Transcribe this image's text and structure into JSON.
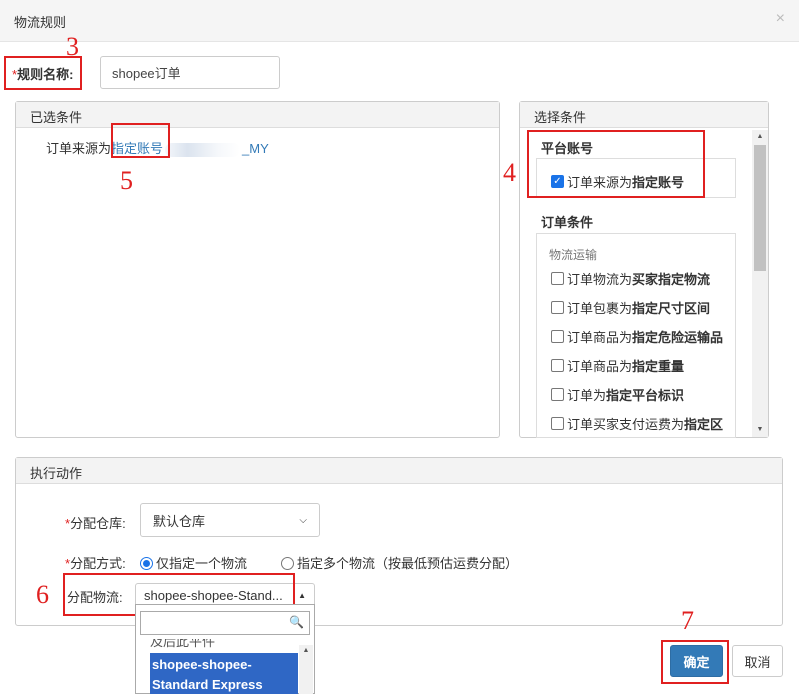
{
  "dialog": {
    "title": "物流规则",
    "close_glyph": "×"
  },
  "annotations": [
    "3",
    "4",
    "5",
    "6",
    "7"
  ],
  "rule_name": {
    "required_mark": "*",
    "label": "规则名称:",
    "value": "shopee订单"
  },
  "selected_panel": {
    "header": "已选条件",
    "condition_prefix": "订单来源为",
    "condition_link": "指定账号",
    "condition_suffix": "_MY"
  },
  "choose_panel": {
    "header": "选择条件",
    "platform_section": "平台账号",
    "platform_option": {
      "prefix": "订单来源为",
      "bold": "指定账号",
      "checked": true
    },
    "order_section": "订单条件",
    "logistics_group": "物流运输",
    "options": [
      {
        "prefix": "订单物流为",
        "bold": "买家指定物流"
      },
      {
        "prefix": "订单包裹为",
        "bold": "指定尺寸区间"
      },
      {
        "prefix": "订单商品为",
        "bold": "指定危险运输品"
      },
      {
        "prefix": "订单商品为",
        "bold": "指定重量"
      },
      {
        "prefix": "订单为",
        "bold": "指定平台标识"
      },
      {
        "prefix": "订单买家支付运费为",
        "bold": "指定区"
      }
    ]
  },
  "action_panel": {
    "header": "执行动作",
    "warehouse_label": "分配仓库:",
    "warehouse_value": "默认仓库",
    "method_label": "分配方式:",
    "method_single": "仅指定一个物流",
    "method_multi": "指定多个物流（按最低预估运费分配）",
    "logistics_label": "分配物流:",
    "logistics_value": "shopee-shopee-Stand...",
    "required_mark": "*"
  },
  "dropdown": {
    "search_value": "",
    "cut_text": "及后此平件",
    "selected_option": "shopee-shopee-Standard Express"
  },
  "buttons": {
    "confirm": "确定",
    "cancel": "取消"
  },
  "colors": {
    "accent": "#337ab7",
    "annotation_red": "#e02020",
    "selected_option_bg": "#2f67c5"
  },
  "icons": [
    "close-icon",
    "checkbox-icon",
    "radio-icon",
    "chevron-down-icon",
    "search-icon",
    "scroll-up-arrow-icon",
    "scroll-down-arrow-icon"
  ]
}
